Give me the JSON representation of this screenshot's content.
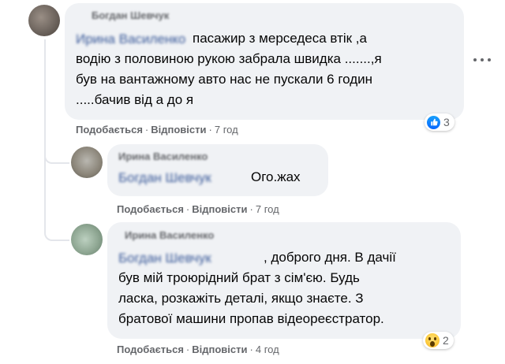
{
  "comments": [
    {
      "author": "Богдан Шевчук",
      "mention": "Ирина Василенко",
      "text": "пасажир з мерседеса втік ,а\nводію з половиною рукою забрала швидка .......,я\nбув на вантажному авто нас не пускали 6 годин\n.....бачив від а до я",
      "like_label": "Подобається",
      "reply_label": "Відповісти",
      "time": "7 год",
      "reaction": {
        "type": "like-icon",
        "count": "3"
      }
    },
    {
      "author": "Ирина Василенко",
      "mention": "Богдан Шевчук",
      "text": "Ого.жах",
      "like_label": "Подобається",
      "reply_label": "Відповісти",
      "time": "7 год"
    },
    {
      "author": "Ирина Василенко",
      "mention": "Богдан Шевчук",
      "text": ", доброго дня. В дачії\nбув мій троюрідний брат з сім'єю. Будь\nласка, розкажіть деталі, якщо знаєте. З\nбратової машини пропав відеореєстратор.",
      "like_label": "Подобається",
      "reply_label": "Відповісти",
      "time": "4 год",
      "reaction": {
        "type": "wow-icon",
        "count": "2"
      }
    }
  ],
  "colors": {
    "bubble": "#f0f2f5",
    "meta": "#65676b",
    "mention": "#385898",
    "like_blue": "#0866ff"
  }
}
